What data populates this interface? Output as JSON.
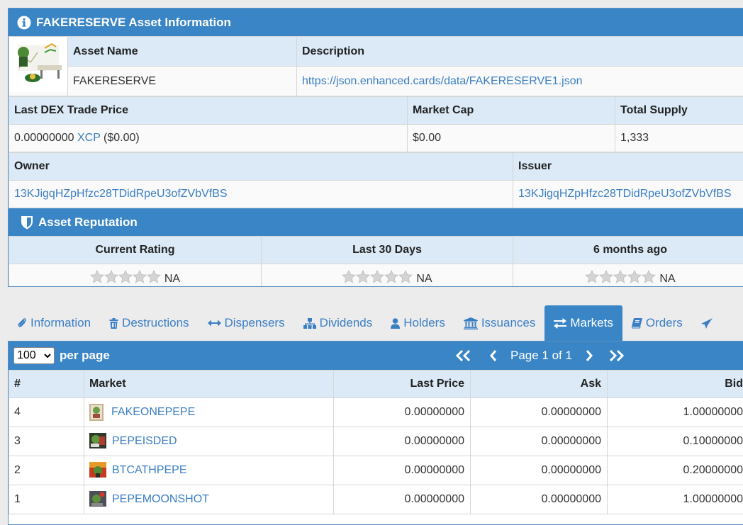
{
  "asset_panel": {
    "title": "FAKERESERVE Asset Information",
    "asset_name_label": "Asset Name",
    "asset_name": "FAKERESERVE",
    "description_label": "Description",
    "description": "https://json.enhanced.cards/data/FAKERESERVE1.json",
    "last_price_label": "Last DEX Trade Price",
    "last_price_value": "0.00000000",
    "last_price_unit": "XCP",
    "last_price_usd": "($0.00)",
    "market_cap_label": "Market Cap",
    "market_cap": "$0.00",
    "total_supply_label": "Total Supply",
    "total_supply": "1,333",
    "owner_label": "Owner",
    "owner": "13KJigqHZpHfzc28TDidRpeU3ofZVbVfBS",
    "issuer_label": "Issuer",
    "issuer": "13KJigqHZpHfzc28TDidRpeU3ofZVbVfBS"
  },
  "reputation": {
    "title": "Asset Reputation",
    "columns": [
      "Current Rating",
      "Last 30 Days",
      "6 months ago"
    ],
    "values": [
      "NA",
      "NA",
      "NA"
    ],
    "stars_filled": [
      0,
      0,
      0
    ],
    "stars_total": 5
  },
  "tabs": [
    {
      "label": "Information",
      "icon": "paperclip-icon"
    },
    {
      "label": "Destructions",
      "icon": "trash-icon"
    },
    {
      "label": "Dispensers",
      "icon": "arrows-h-icon"
    },
    {
      "label": "Dividends",
      "icon": "sitemap-icon"
    },
    {
      "label": "Holders",
      "icon": "user-icon"
    },
    {
      "label": "Issuances",
      "icon": "bank-icon"
    },
    {
      "label": "Markets",
      "icon": "exchange-icon",
      "active": true
    },
    {
      "label": "Orders",
      "icon": "book-icon"
    }
  ],
  "markets": {
    "per_page_value": "100",
    "per_page_label": "per page",
    "page_text": "Page 1 of 1",
    "columns": [
      "#",
      "Market",
      "Last Price",
      "Ask",
      "Bid"
    ],
    "rows": [
      {
        "num": "4",
        "market": "FAKEONEPEPE",
        "last": "0.00000000",
        "ask": "0.00000000",
        "bid": "1.00000000"
      },
      {
        "num": "3",
        "market": "PEPEISDED",
        "last": "0.00000000",
        "ask": "0.00000000",
        "bid": "0.10000000"
      },
      {
        "num": "2",
        "market": "BTCATHPEPE",
        "last": "0.00000000",
        "ask": "0.00000000",
        "bid": "0.20000000"
      },
      {
        "num": "1",
        "market": "PEPEMOONSHOT",
        "last": "0.00000000",
        "ask": "0.00000000",
        "bid": "1.00000000"
      }
    ]
  },
  "colors": {
    "header_blue": "#3a85c6",
    "header_row": "#dbeaf6",
    "link": "#3a7ec4"
  }
}
